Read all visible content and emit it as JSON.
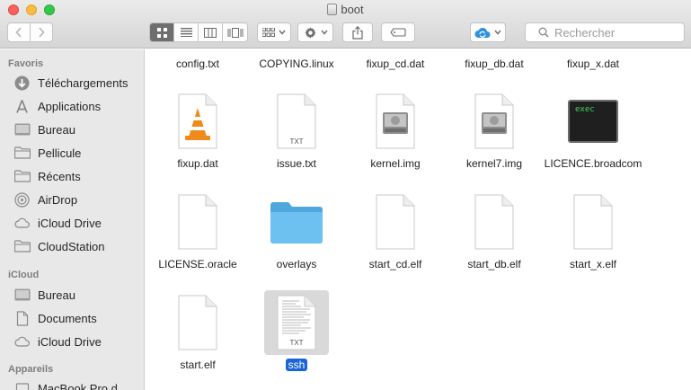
{
  "window": {
    "title": "boot"
  },
  "toolbar": {
    "search_placeholder": "Rechercher",
    "view_modes": [
      "icon-view",
      "list-view",
      "column-view",
      "coverflow-view"
    ]
  },
  "sidebar": {
    "sections": [
      {
        "title": "Favoris",
        "items": [
          {
            "label": "Téléchargements",
            "icon": "download-icon"
          },
          {
            "label": "Applications",
            "icon": "applications-icon"
          },
          {
            "label": "Bureau",
            "icon": "desktop-icon"
          },
          {
            "label": "Pellicule",
            "icon": "folder-icon"
          },
          {
            "label": "Récents",
            "icon": "folder-icon"
          },
          {
            "label": "AirDrop",
            "icon": "airdrop-icon"
          },
          {
            "label": "iCloud Drive",
            "icon": "cloud-icon"
          },
          {
            "label": "CloudStation",
            "icon": "folder-icon"
          }
        ]
      },
      {
        "title": "iCloud",
        "items": [
          {
            "label": "Bureau",
            "icon": "desktop-icon"
          },
          {
            "label": "Documents",
            "icon": "documents-icon"
          },
          {
            "label": "iCloud Drive",
            "icon": "cloud-icon"
          }
        ]
      },
      {
        "title": "Appareils",
        "items": [
          {
            "label": "MacBook Pro d",
            "icon": "laptop-icon"
          }
        ]
      }
    ]
  },
  "files": {
    "top_row": [
      "config.txt",
      "COPYING.linux",
      "fixup_cd.dat",
      "fixup_db.dat",
      "fixup_x.dat"
    ],
    "grid": [
      {
        "name": "fixup.dat",
        "icon": "vlc-icon"
      },
      {
        "name": "issue.txt",
        "icon": "txt-document-icon",
        "badge": "TXT"
      },
      {
        "name": "kernel.img",
        "icon": "disk-image-icon"
      },
      {
        "name": "kernel7.img",
        "icon": "disk-image-icon"
      },
      {
        "name": "LICENCE.broadcom",
        "icon": "executable-icon",
        "badge": "exec"
      },
      {
        "name": "LICENSE.oracle",
        "icon": "blank-document-icon"
      },
      {
        "name": "overlays",
        "icon": "folder-icon"
      },
      {
        "name": "start_cd.elf",
        "icon": "blank-document-icon"
      },
      {
        "name": "start_db.elf",
        "icon": "blank-document-icon"
      },
      {
        "name": "start_x.elf",
        "icon": "blank-document-icon"
      },
      {
        "name": "start.elf",
        "icon": "blank-document-icon"
      },
      {
        "name": "ssh",
        "icon": "txt-document-icon",
        "badge": "TXT",
        "selected": true
      }
    ]
  },
  "colors": {
    "selection": "#1b64d5",
    "folder": "#5ab8ee",
    "sidebar_bg": "#e9e8e9"
  }
}
